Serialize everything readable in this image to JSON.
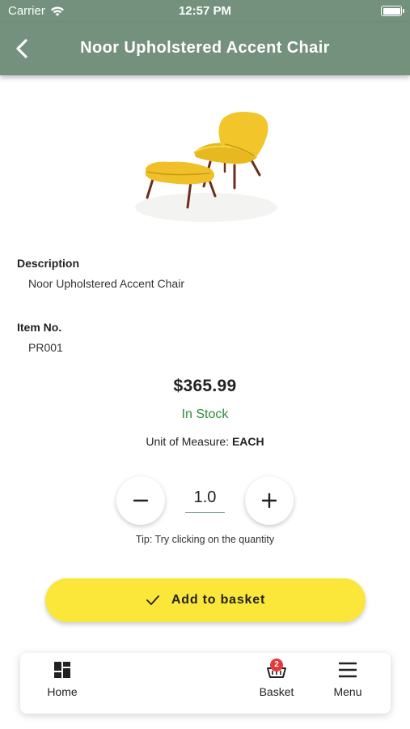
{
  "status_bar": {
    "carrier": "Carrier",
    "time": "12:57 PM"
  },
  "header": {
    "title": "Noor Upholstered Accent Chair"
  },
  "product": {
    "image_icon": "yellow-accent-chair-with-ottoman",
    "description_label": "Description",
    "description": "Noor Upholstered Accent Chair",
    "item_no_label": "Item No.",
    "item_no": "PR001",
    "price": "$365.99",
    "stock_status": "In Stock",
    "uom_label": "Unit of Measure:",
    "uom_value": "EACH"
  },
  "quantity": {
    "value": "1.0",
    "decrement_icon": "minus-icon",
    "increment_icon": "plus-icon",
    "tip": "Tip: Try clicking on the quantity"
  },
  "actions": {
    "add_to_basket": "Add to basket"
  },
  "bottom_nav": {
    "home": "Home",
    "basket": "Basket",
    "basket_count": "2",
    "menu": "Menu"
  },
  "colors": {
    "header_bg": "#73917d",
    "accent_yellow": "#fbe63a",
    "stock_green": "#2e8b3a",
    "badge_red": "#e63a3a"
  }
}
